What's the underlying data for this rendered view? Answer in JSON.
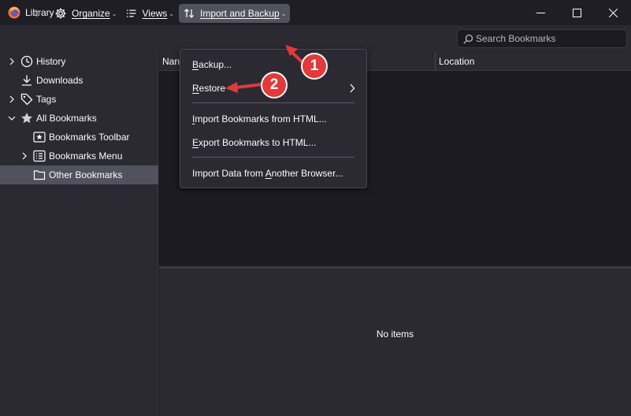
{
  "window": {
    "title": "Library",
    "icon": "firefox-icon",
    "controls": [
      "minimize-icon",
      "maximize-icon",
      "close-icon"
    ]
  },
  "toolbar": {
    "back_icon": "arrow-left-icon",
    "forward_icon": "arrow-right-icon",
    "organize": "Organize",
    "views": "Views",
    "import_backup": "Import and Backup",
    "search_placeholder": "Search Bookmarks"
  },
  "sidebar": {
    "items": [
      {
        "label": "History",
        "icon": "clock-icon",
        "expander": "collapsed"
      },
      {
        "label": "Downloads",
        "icon": "download-icon",
        "expander": "none"
      },
      {
        "label": "Tags",
        "icon": "tag-icon",
        "expander": "collapsed"
      },
      {
        "label": "All Bookmarks",
        "icon": "star-icon",
        "expander": "expanded"
      },
      {
        "label": "Bookmarks Toolbar",
        "icon": "bookmarks-toolbar-icon",
        "expander": "none"
      },
      {
        "label": "Bookmarks Menu",
        "icon": "bookmarks-menu-icon",
        "expander": "collapsed"
      },
      {
        "label": "Other Bookmarks",
        "icon": "folder-icon",
        "expander": "none",
        "selected": true
      }
    ]
  },
  "columns": {
    "name": "Nan",
    "location": "Location"
  },
  "details": {
    "empty_text": "No items"
  },
  "menu": {
    "items": [
      {
        "label": "Backup...",
        "accesskey": "B"
      },
      {
        "label": "Restore",
        "accesskey": "R",
        "has_submenu": true
      },
      {
        "label": "Import Bookmarks from HTML...",
        "accesskey": "I"
      },
      {
        "label": "Export Bookmarks to HTML...",
        "accesskey": "E"
      },
      {
        "label": "Import Data from Another Browser...",
        "accesskey": "A"
      }
    ]
  },
  "annotations": {
    "step1": "1",
    "step2": "2",
    "color": "#e23a3a"
  },
  "colors": {
    "background": "#1c1b22",
    "panel": "#2b2a33",
    "selected": "#52525e",
    "text": "#fbfbfe"
  }
}
